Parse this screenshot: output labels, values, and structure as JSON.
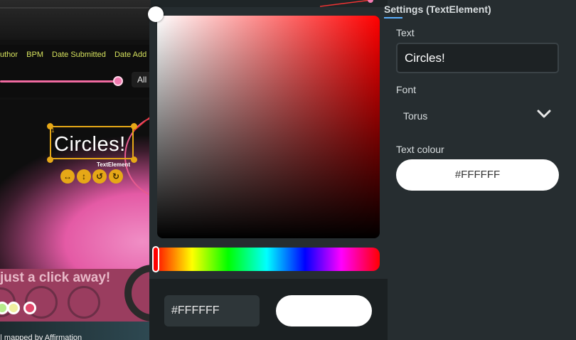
{
  "preview": {
    "filter_tabs": [
      "uthor",
      "BPM",
      "Date Submitted",
      "Date Add"
    ],
    "all_button": "All",
    "banner_text": "just a click away!",
    "bottom_text": "| mapped by Affirmation"
  },
  "text_element": {
    "text": "Circles!",
    "type_tag": "TextElement",
    "anchor_mark": "1",
    "tools": [
      "↔",
      "↕",
      "↺",
      "↻"
    ]
  },
  "color_picker": {
    "hex_value": "#FFFFFF",
    "hue_color": "#ff0000",
    "preview_color": "#ffffff"
  },
  "settings": {
    "title": "Settings (TextElement)",
    "text_label": "Text",
    "text_value": "Circles!",
    "font_label": "Font",
    "font_value": "Torus",
    "colour_label": "Text colour",
    "colour_value": "#FFFFFF"
  },
  "colors": {
    "accent_selection": "#e6a817",
    "panel_bg": "#262d30",
    "filter_tab_text": "#d6e25e"
  }
}
